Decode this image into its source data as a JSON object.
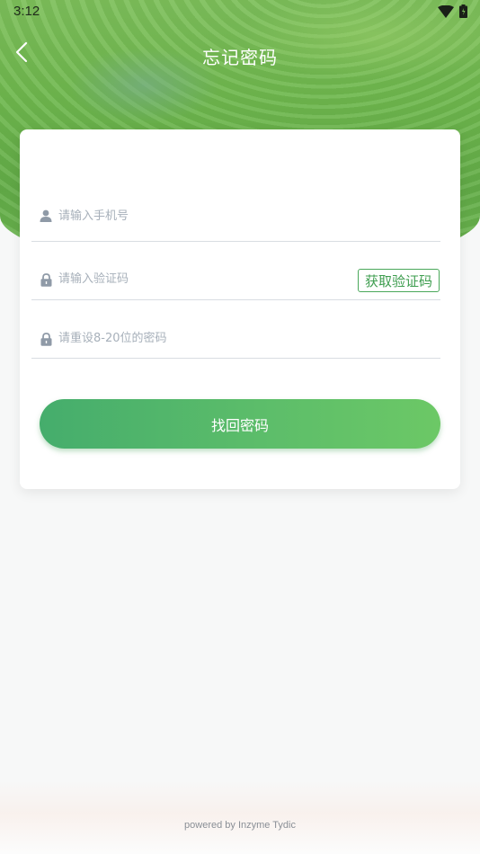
{
  "status_bar": {
    "time": "3:12",
    "icons": [
      "wifi-icon",
      "battery-icon"
    ]
  },
  "header": {
    "title": "忘记密码",
    "back_icon": "back-arrow-icon"
  },
  "form": {
    "phone": {
      "placeholder": "请输入手机号",
      "value": "",
      "icon": "user-icon"
    },
    "code": {
      "placeholder": "请输入验证码",
      "value": "",
      "icon": "lock-icon",
      "get_code_label": "获取验证码"
    },
    "password": {
      "placeholder": "请重设8-20位的密码",
      "value": "",
      "icon": "lock-icon"
    },
    "submit_label": "找回密码"
  },
  "footer": {
    "text": "powered by Inzyme Tydic"
  },
  "colors": {
    "accent": "#4aa85a",
    "button_start": "#45ad6c",
    "button_end": "#6cc866",
    "placeholder": "#a7b0ba"
  }
}
